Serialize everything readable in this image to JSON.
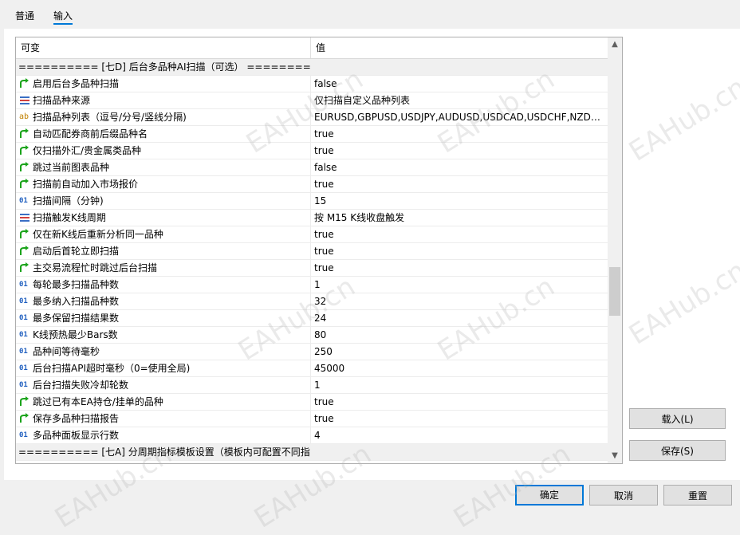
{
  "tabs": [
    {
      "label": "普通",
      "active": false
    },
    {
      "label": "输入",
      "active": true
    }
  ],
  "grid": {
    "headers": {
      "name": "可变",
      "value": "值"
    },
    "rows": [
      {
        "type": "section",
        "name": "========== [七D] 后台多品种AI扫描（可选） ==========",
        "value": ""
      },
      {
        "type": "bool",
        "icon": "green-arrow-icon",
        "name": "启用后台多品种扫描",
        "value": "false"
      },
      {
        "type": "enum",
        "icon": "enum-list-icon",
        "name": "扫描品种来源",
        "value": "仅扫描自定义品种列表"
      },
      {
        "type": "string",
        "icon": "ab-text-icon",
        "name": "扫描品种列表（逗号/分号/竖线分隔)",
        "value": "EURUSD,GBPUSD,USDJPY,AUDUSD,USDCAD,USDCHF,NZDUS..."
      },
      {
        "type": "bool",
        "icon": "green-arrow-icon",
        "name": "自动匹配券商前后缀品种名",
        "value": "true"
      },
      {
        "type": "bool",
        "icon": "green-arrow-icon",
        "name": "仅扫描外汇/贵金属类品种",
        "value": "true"
      },
      {
        "type": "bool",
        "icon": "green-arrow-icon",
        "name": "跳过当前图表品种",
        "value": "false"
      },
      {
        "type": "bool",
        "icon": "green-arrow-icon",
        "name": "扫描前自动加入市场报价",
        "value": "true"
      },
      {
        "type": "int",
        "icon": "int-01-icon",
        "name": "扫描间隔（分钟)",
        "value": "15"
      },
      {
        "type": "enum",
        "icon": "enum-list-icon",
        "name": "扫描触发K线周期",
        "value": "按 M15 K线收盘触发"
      },
      {
        "type": "bool",
        "icon": "green-arrow-icon",
        "name": "仅在新K线后重新分析同一品种",
        "value": "true"
      },
      {
        "type": "bool",
        "icon": "green-arrow-icon",
        "name": "启动后首轮立即扫描",
        "value": "true"
      },
      {
        "type": "bool",
        "icon": "green-arrow-icon",
        "name": "主交易流程忙时跳过后台扫描",
        "value": "true"
      },
      {
        "type": "int",
        "icon": "int-01-icon",
        "name": "每轮最多扫描品种数",
        "value": "1"
      },
      {
        "type": "int",
        "icon": "int-01-icon",
        "name": "最多纳入扫描品种数",
        "value": "32"
      },
      {
        "type": "int",
        "icon": "int-01-icon",
        "name": "最多保留扫描结果数",
        "value": "24"
      },
      {
        "type": "int",
        "icon": "int-01-icon",
        "name": "K线预热最少Bars数",
        "value": "80"
      },
      {
        "type": "int",
        "icon": "int-01-icon",
        "name": "品种间等待毫秒",
        "value": "250"
      },
      {
        "type": "int",
        "icon": "int-01-icon",
        "name": "后台扫描API超时毫秒（0=使用全局)",
        "value": "45000"
      },
      {
        "type": "int",
        "icon": "int-01-icon",
        "name": "后台扫描失败冷却轮数",
        "value": "1"
      },
      {
        "type": "bool",
        "icon": "green-arrow-icon",
        "name": "跳过已有本EA持仓/挂单的品种",
        "value": "true"
      },
      {
        "type": "bool",
        "icon": "green-arrow-icon",
        "name": "保存多品种扫描报告",
        "value": "true"
      },
      {
        "type": "int",
        "icon": "int-01-icon",
        "name": "多品种面板显示行数",
        "value": "4"
      },
      {
        "type": "section",
        "name": "========== [七A] 分周期指标模板设置（模板内可配置不同指...",
        "value": ""
      }
    ]
  },
  "scroll": {
    "position_fraction": 0.56
  },
  "side_buttons": {
    "load": "载入(L)",
    "save": "保存(S)"
  },
  "footer_buttons": {
    "ok": "确定",
    "cancel": "取消",
    "reset": "重置"
  },
  "watermark": "EAHub.cn",
  "colors": {
    "accent": "#0078d7",
    "bool_icon": "#1aa31a",
    "int_icon": "#1f5fbf"
  }
}
